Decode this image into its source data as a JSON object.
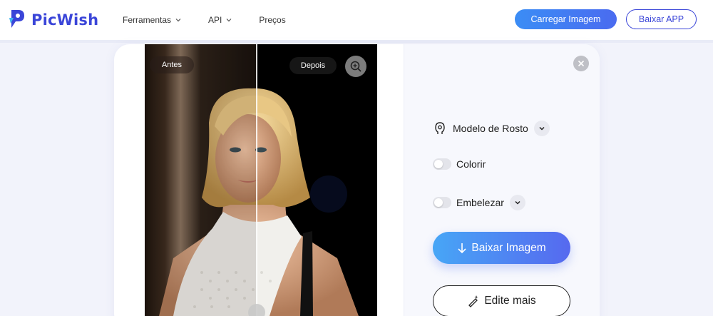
{
  "brand": {
    "name": "PicWish",
    "color": "#3a45d8"
  },
  "nav": {
    "items": [
      {
        "label": "Ferramentas",
        "has_dropdown": true
      },
      {
        "label": "API",
        "has_dropdown": true
      },
      {
        "label": "Preços",
        "has_dropdown": false
      }
    ]
  },
  "header": {
    "upload_label": "Carregar Imagem",
    "app_label": "Baixar APP"
  },
  "preview": {
    "before_label": "Antes",
    "after_label": "Depois"
  },
  "options": {
    "face_model_label": "Modelo de Rosto",
    "colorize_label": "Colorir",
    "colorize_on": false,
    "beautify_label": "Embelezar",
    "beautify_on": false
  },
  "actions": {
    "download_label": "Baixar Imagem",
    "edit_label": "Edite mais"
  },
  "colors": {
    "accent": "#4a6bf0",
    "background": "#f2f3fb"
  }
}
